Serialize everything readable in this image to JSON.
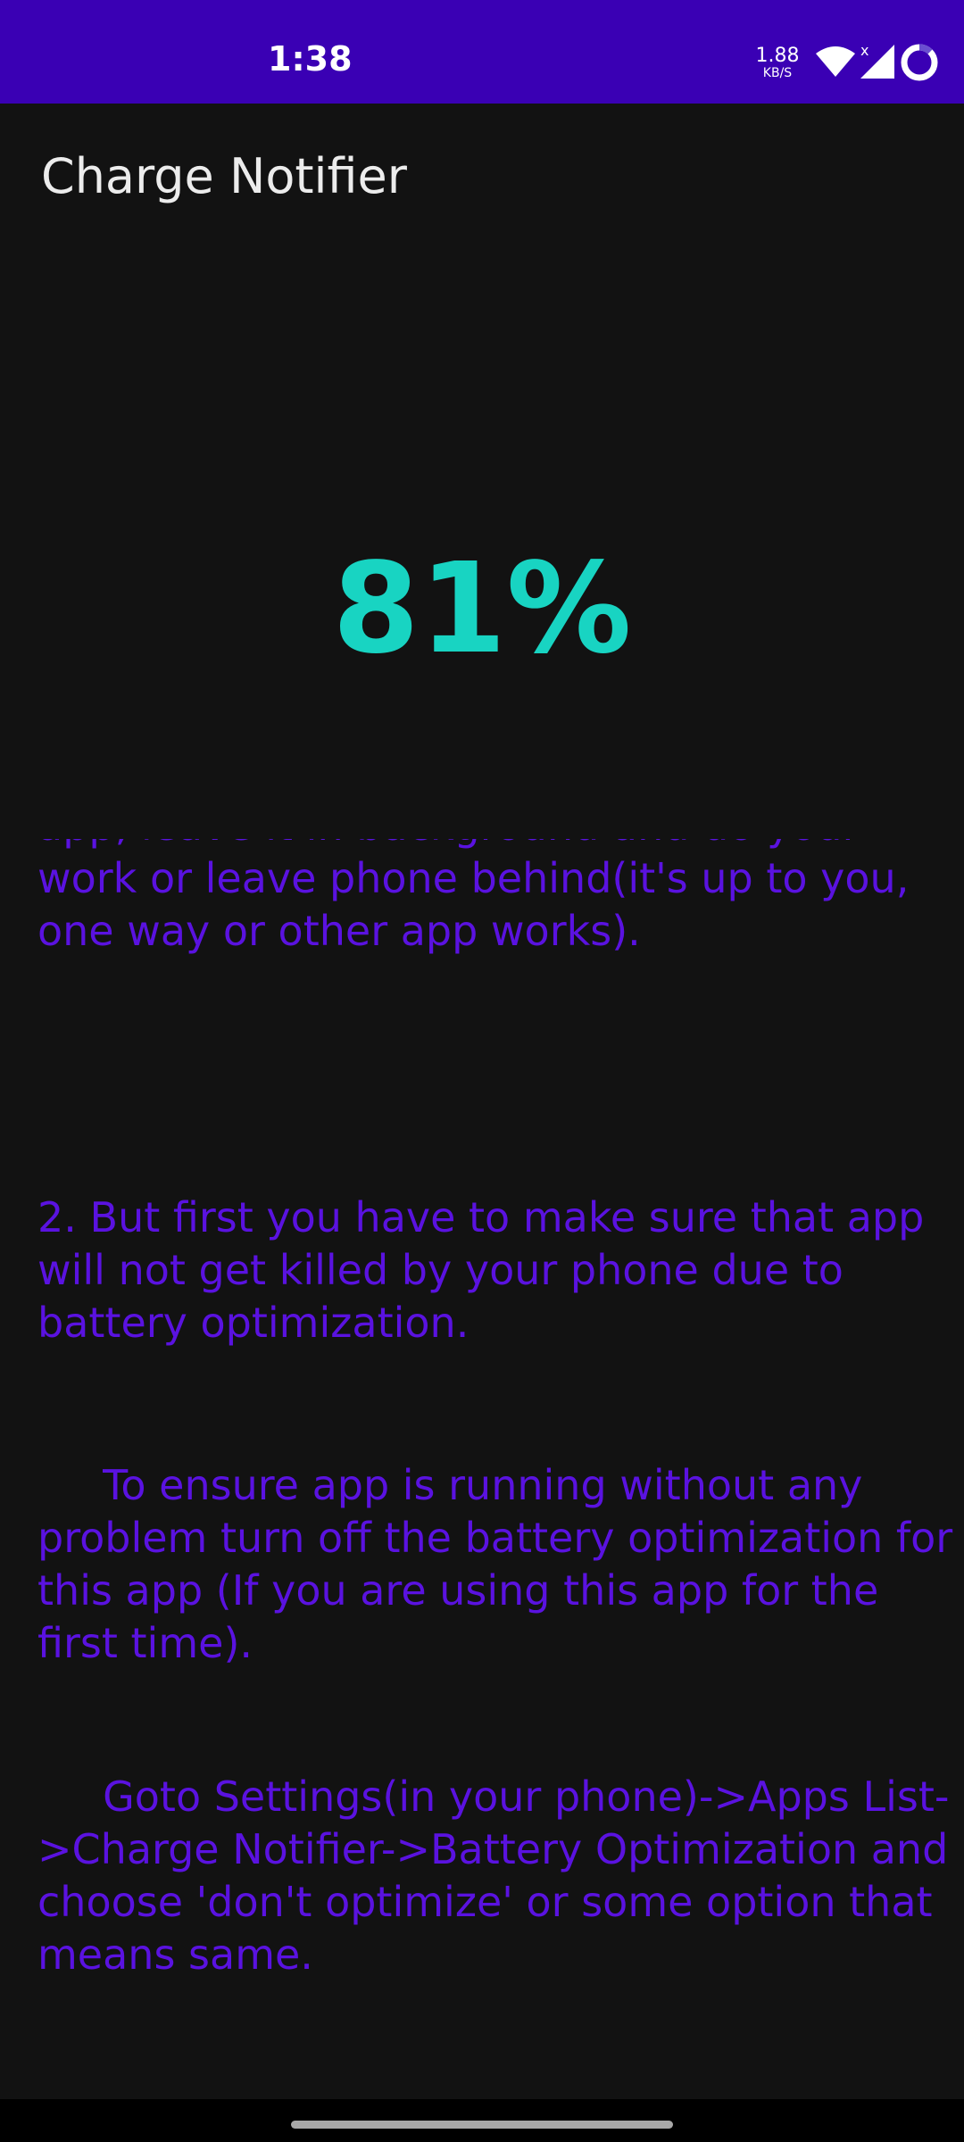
{
  "status_bar": {
    "time": "1:38",
    "net_speed_value": "1.88",
    "net_speed_unit": "KB/S",
    "background": "#3a00b4",
    "icons": [
      "wifi-icon",
      "signal-icon",
      "battery-saver-icon"
    ]
  },
  "app": {
    "title": "Charge Notifier",
    "battery_percent": "81%",
    "accent_color": "#18d4c2",
    "text_color": "#5a12e0"
  },
  "instructions": [
    "app, leave it in background and do your work or leave phone behind(it's up to you, one way or other app works).",
    "2. But first you have to make sure that app will not get killed by your phone due to battery optimization.",
    "     To ensure app is running without any problem turn off the battery optimization for this app (If you are using this app for the first time).",
    "     Goto Settings(in your phone)->Apps List->Charge Notifier->Battery Optimization and choose 'don't optimize' or some option that means same."
  ]
}
